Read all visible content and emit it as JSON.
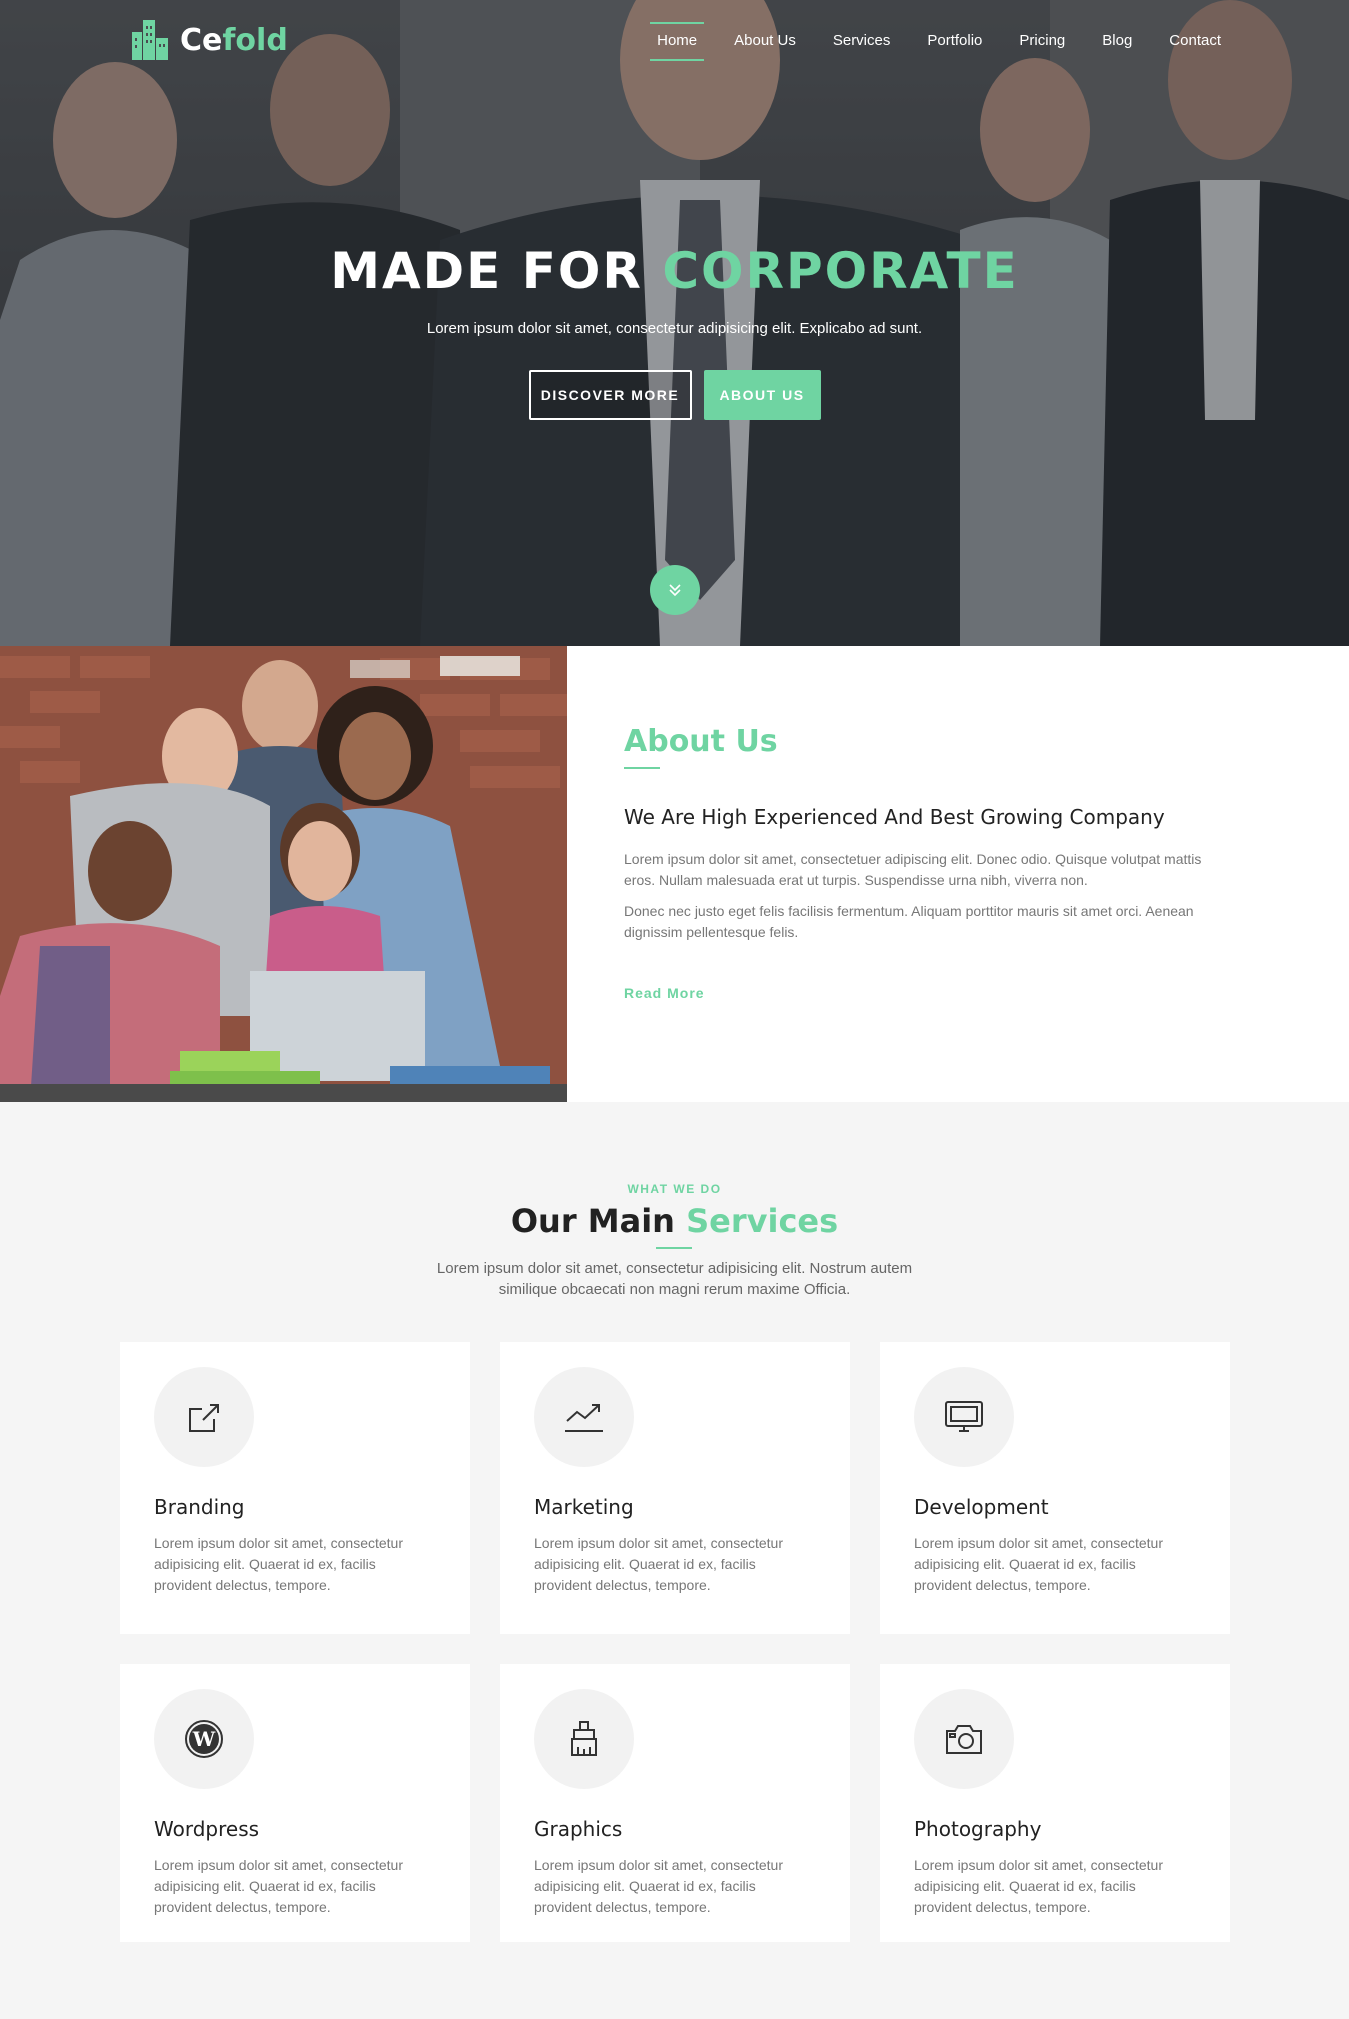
{
  "brand": {
    "logo_prefix": "Ce",
    "logo_suffix": "fold"
  },
  "nav": {
    "items": [
      "Home",
      "About Us",
      "Services",
      "Portfolio",
      "Pricing",
      "Blog",
      "Contact"
    ],
    "active": "Home"
  },
  "hero": {
    "title_white": "MADE FOR",
    "title_accent": "CORPORATE",
    "subtitle": "Lorem ipsum dolor sit amet, consectetur adipisicing elit. Explicabo ad sunt.",
    "btn_discover": "Discover More",
    "btn_about": "About Us"
  },
  "about": {
    "heading": "About Us",
    "subheading": "We Are High Experienced And Best Growing Company",
    "para1": "Lorem ipsum dolor sit amet, consectetuer adipiscing elit. Donec odio. Quisque volutpat mattis eros. Nullam malesuada erat ut turpis. Suspendisse urna nibh, viverra non.",
    "para2": "Donec nec justo eget felis facilisis fermentum. Aliquam porttitor mauris sit amet orci. Aenean dignissim pellentesque felis.",
    "read_more": "Read More"
  },
  "services": {
    "kicker": "WHAT WE DO",
    "title_dark": "Our Main",
    "title_accent": "Services",
    "intro": "Lorem ipsum dolor sit amet, consectetur adipisicing elit. Nostrum autem similique obcaecati non magni rerum maxime Officia.",
    "cards": [
      {
        "title": "Branding",
        "icon": "external-link-icon",
        "text": "Lorem ipsum dolor sit amet, consectetur adipisicing elit. Quaerat id ex, facilis provident delectus, tempore."
      },
      {
        "title": "Marketing",
        "icon": "trend-chart-icon",
        "text": "Lorem ipsum dolor sit amet, consectetur adipisicing elit. Quaerat id ex, facilis provident delectus, tempore."
      },
      {
        "title": "Development",
        "icon": "monitor-icon",
        "text": "Lorem ipsum dolor sit amet, consectetur adipisicing elit. Quaerat id ex, facilis provident delectus, tempore."
      },
      {
        "title": "Wordpress",
        "icon": "wordpress-icon",
        "text": "Lorem ipsum dolor sit amet, consectetur adipisicing elit. Quaerat id ex, facilis provident delectus, tempore."
      },
      {
        "title": "Graphics",
        "icon": "paint-brush-icon",
        "text": "Lorem ipsum dolor sit amet, consectetur adipisicing elit. Quaerat id ex, facilis provident delectus, tempore."
      },
      {
        "title": "Photography",
        "icon": "camera-icon",
        "text": "Lorem ipsum dolor sit amet, consectetur adipisicing elit. Quaerat id ex, facilis provident delectus, tempore."
      }
    ]
  },
  "colors": {
    "accent": "#6fd4a2",
    "background": "#f5f5f5",
    "card": "#ffffff"
  }
}
